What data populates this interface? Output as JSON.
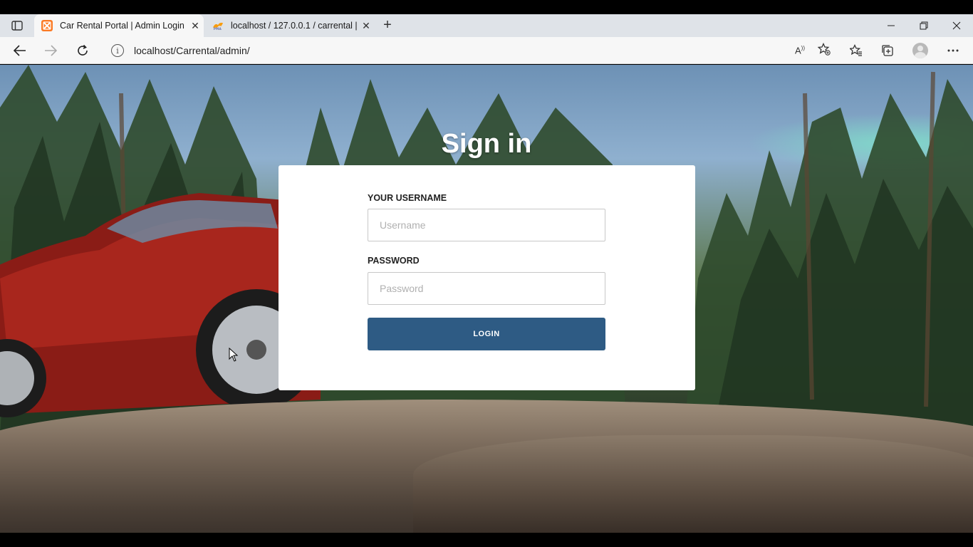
{
  "browser": {
    "tabs": [
      {
        "title": "Car Rental Portal | Admin Login",
        "favicon": "xampp-icon"
      },
      {
        "title": "localhost / 127.0.0.1 / carrental |",
        "favicon": "phpmyadmin-icon"
      }
    ],
    "close_glyph": "✕",
    "new_tab_glyph": "+",
    "address_url": "localhost/Carrental/admin/",
    "info_glyph": "i"
  },
  "page": {
    "heading": "Sign in",
    "username_label": "YOUR USERNAME",
    "username_placeholder": "Username",
    "password_label": "PASSWORD",
    "password_placeholder": "Password",
    "login_label": "LOGIN"
  },
  "colors": {
    "login_button": "#2e5b84",
    "card": "#ffffff"
  }
}
